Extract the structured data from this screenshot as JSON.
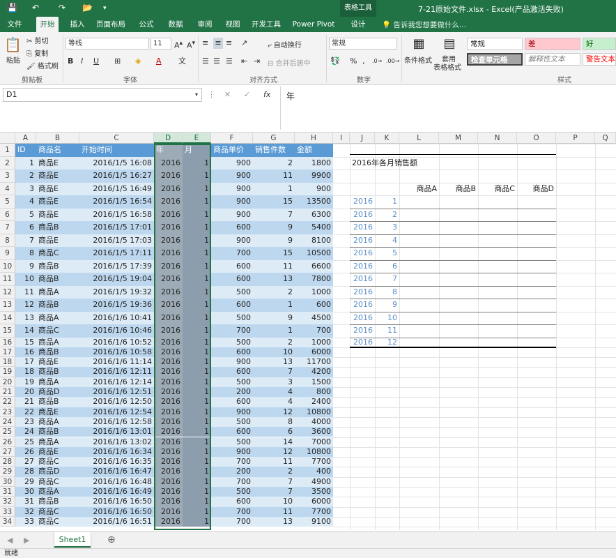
{
  "title_bar": {
    "context_tab": "表格工具",
    "document_title": "7-21原始文件.xlsx - Excel(产品激活失败)"
  },
  "ribbon_tabs": [
    "文件",
    "开始",
    "插入",
    "页面布局",
    "公式",
    "数据",
    "审阅",
    "视图",
    "开发工具",
    "Power Pivot",
    "设计"
  ],
  "active_tab": "开始",
  "tell_me": "告诉我您想要做什么...",
  "clipboard": {
    "paste": "粘贴",
    "cut": "剪切",
    "copy": "复制",
    "format_painter": "格式刷",
    "group": "剪贴板"
  },
  "font": {
    "name": "等线",
    "size": "11",
    "bold": "B",
    "italic": "I",
    "underline": "U",
    "group": "字体"
  },
  "alignment": {
    "wrap": "自动换行",
    "merge": "合并后居中",
    "group": "对齐方式"
  },
  "number": {
    "format": "常规",
    "percent": "%",
    "comma": ",",
    "group": "数字"
  },
  "styles": {
    "conditional": "条件格式",
    "table_format_line1": "套用",
    "table_format_line2": "表格格式",
    "normal": "常规",
    "bad": "差",
    "good": "好",
    "check_cell": "检查单元格",
    "explanatory": "解释性文本",
    "warning": "警告文本",
    "group": "样式"
  },
  "formula_bar": {
    "name_box": "D1",
    "fx": "fx",
    "content": "年"
  },
  "columns": [
    "A",
    "B",
    "C",
    "D",
    "E",
    "F",
    "G",
    "H",
    "I",
    "J",
    "K",
    "L",
    "M",
    "N",
    "O",
    "P",
    "Q"
  ],
  "headers": [
    "ID",
    "商品名",
    "开始时间",
    "年",
    "月",
    "商品单价",
    "销售件数",
    "金额"
  ],
  "rows": [
    [
      "1",
      "商品E",
      "2016/1/5 16:08",
      "2016",
      "1",
      "900",
      "2",
      "1800"
    ],
    [
      "2",
      "商品E",
      "2016/1/5 16:27",
      "2016",
      "1",
      "900",
      "11",
      "9900"
    ],
    [
      "3",
      "商品E",
      "2016/1/5 16:49",
      "2016",
      "1",
      "900",
      "1",
      "900"
    ],
    [
      "4",
      "商品E",
      "2016/1/5 16:54",
      "2016",
      "1",
      "900",
      "15",
      "13500"
    ],
    [
      "5",
      "商品E",
      "2016/1/5 16:58",
      "2016",
      "1",
      "900",
      "7",
      "6300"
    ],
    [
      "6",
      "商品B",
      "2016/1/5 17:01",
      "2016",
      "1",
      "600",
      "9",
      "5400"
    ],
    [
      "7",
      "商品E",
      "2016/1/5 17:03",
      "2016",
      "1",
      "900",
      "9",
      "8100"
    ],
    [
      "8",
      "商品C",
      "2016/1/5 17:11",
      "2016",
      "1",
      "700",
      "15",
      "10500"
    ],
    [
      "9",
      "商品B",
      "2016/1/5 17:39",
      "2016",
      "1",
      "600",
      "11",
      "6600"
    ],
    [
      "10",
      "商品B",
      "2016/1/5 19:04",
      "2016",
      "1",
      "600",
      "13",
      "7800"
    ],
    [
      "11",
      "商品A",
      "2016/1/5 19:32",
      "2016",
      "1",
      "500",
      "2",
      "1000"
    ],
    [
      "12",
      "商品B",
      "2016/1/5 19:36",
      "2016",
      "1",
      "600",
      "1",
      "600"
    ],
    [
      "13",
      "商品A",
      "2016/1/6 10:41",
      "2016",
      "1",
      "500",
      "9",
      "4500"
    ],
    [
      "14",
      "商品C",
      "2016/1/6 10:46",
      "2016",
      "1",
      "700",
      "1",
      "700"
    ],
    [
      "15",
      "商品A",
      "2016/1/6 10:52",
      "2016",
      "1",
      "500",
      "2",
      "1000"
    ],
    [
      "16",
      "商品B",
      "2016/1/6 10:58",
      "2016",
      "1",
      "600",
      "10",
      "6000"
    ],
    [
      "17",
      "商品E",
      "2016/1/6 11:14",
      "2016",
      "1",
      "900",
      "13",
      "11700"
    ],
    [
      "18",
      "商品B",
      "2016/1/6 12:11",
      "2016",
      "1",
      "600",
      "7",
      "4200"
    ],
    [
      "19",
      "商品A",
      "2016/1/6 12:14",
      "2016",
      "1",
      "500",
      "3",
      "1500"
    ],
    [
      "20",
      "商品D",
      "2016/1/6 12:51",
      "2016",
      "1",
      "200",
      "4",
      "800"
    ],
    [
      "21",
      "商品B",
      "2016/1/6 12:50",
      "2016",
      "1",
      "600",
      "4",
      "2400"
    ],
    [
      "22",
      "商品E",
      "2016/1/6 12:54",
      "2016",
      "1",
      "900",
      "12",
      "10800"
    ],
    [
      "23",
      "商品A",
      "2016/1/6 12:58",
      "2016",
      "1",
      "500",
      "8",
      "4000"
    ],
    [
      "24",
      "商品B",
      "2016/1/6 13:01",
      "2016",
      "1",
      "600",
      "6",
      "3600"
    ],
    [
      "25",
      "商品A",
      "2016/1/6 13:02",
      "2016",
      "1",
      "500",
      "14",
      "7000"
    ],
    [
      "26",
      "商品E",
      "2016/1/6 16:34",
      "2016",
      "1",
      "900",
      "12",
      "10800"
    ],
    [
      "27",
      "商品C",
      "2016/1/6 16:35",
      "2016",
      "1",
      "700",
      "11",
      "7700"
    ],
    [
      "28",
      "商品D",
      "2016/1/6 16:47",
      "2016",
      "1",
      "200",
      "2",
      "400"
    ],
    [
      "29",
      "商品C",
      "2016/1/6 16:48",
      "2016",
      "1",
      "700",
      "7",
      "4900"
    ],
    [
      "30",
      "商品A",
      "2016/1/6 16:49",
      "2016",
      "1",
      "500",
      "7",
      "3500"
    ],
    [
      "31",
      "商品B",
      "2016/1/6 16:50",
      "2016",
      "1",
      "600",
      "10",
      "6000"
    ],
    [
      "32",
      "商品C",
      "2016/1/6 16:50",
      "2016",
      "1",
      "700",
      "11",
      "7700"
    ],
    [
      "33",
      "商品C",
      "2016/1/6 16:51",
      "2016",
      "1",
      "700",
      "13",
      "9100"
    ]
  ],
  "summary": {
    "title": "2016年各月销售额",
    "products": [
      "商品A",
      "商品B",
      "商品C",
      "商品D"
    ],
    "year": "2016",
    "months": [
      "1",
      "2",
      "3",
      "4",
      "5",
      "6",
      "7",
      "8",
      "9",
      "10",
      "11",
      "12"
    ]
  },
  "sheet_tab": "Sheet1",
  "add_sheet": "⊕",
  "status": "就绪"
}
